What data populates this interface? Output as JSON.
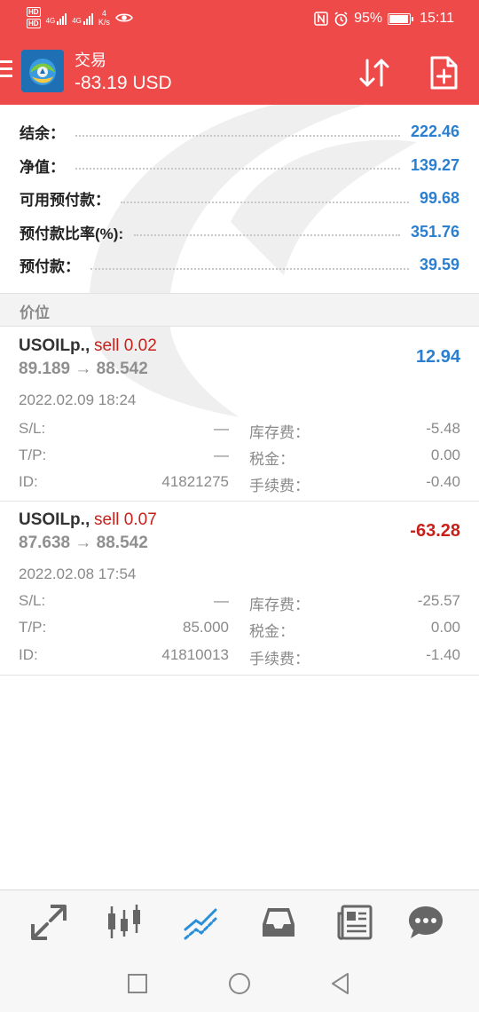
{
  "status_bar": {
    "hd1": "HD",
    "hd2": "HD",
    "net1": "4G",
    "net2": "4G",
    "speed": "4",
    "speed_unit": "K/s",
    "battery": "95%",
    "time": "15:11"
  },
  "app_bar": {
    "title": "交易",
    "balance": "-83.19 USD"
  },
  "summary": [
    {
      "label": "结余：",
      "value": "222.46"
    },
    {
      "label": "净值：",
      "value": "139.27"
    },
    {
      "label": "可用预付款：",
      "value": "99.68"
    },
    {
      "label": "预付款比率(%):",
      "value": "351.76"
    },
    {
      "label": "预付款：",
      "value": "39.59"
    }
  ],
  "section_title": "价位",
  "positions": [
    {
      "symbol": "USOILp.,",
      "side": "sell 0.02",
      "prices": "89.189 → 88.542",
      "profit": "12.94",
      "time": "2022.02.09 18:24",
      "sl_label": "S/L:",
      "sl": "—",
      "tp_label": "T/P:",
      "tp": "—",
      "id_label": "ID:",
      "id": "41821275",
      "swap_label": "库存费：",
      "swap": "-5.48",
      "tax_label": "税金：",
      "tax": "0.00",
      "fee_label": "手续费：",
      "fee": "-0.40"
    },
    {
      "symbol": "USOILp.,",
      "side": "sell 0.07",
      "prices": "87.638 → 88.542",
      "profit": "-63.28",
      "time": "2022.02.08 17:54",
      "sl_label": "S/L:",
      "sl": "—",
      "tp_label": "T/P:",
      "tp": "85.000",
      "id_label": "ID:",
      "id": "41810013",
      "swap_label": "库存费：",
      "swap": "-25.57",
      "tax_label": "税金：",
      "tax": "0.00",
      "fee_label": "手续费：",
      "fee": "-1.40"
    }
  ],
  "bottom_nav": [
    {
      "icon": "trade-arrows-icon"
    },
    {
      "icon": "candlestick-chart-icon"
    },
    {
      "icon": "trend-lines-icon",
      "active": true
    },
    {
      "icon": "inbox-icon"
    },
    {
      "icon": "news-icon"
    },
    {
      "icon": "chat-icon"
    }
  ],
  "colors": {
    "accent": "#ef4a4a",
    "profit_positive": "#2a7fd0",
    "profit_negative": "#c8201a"
  }
}
